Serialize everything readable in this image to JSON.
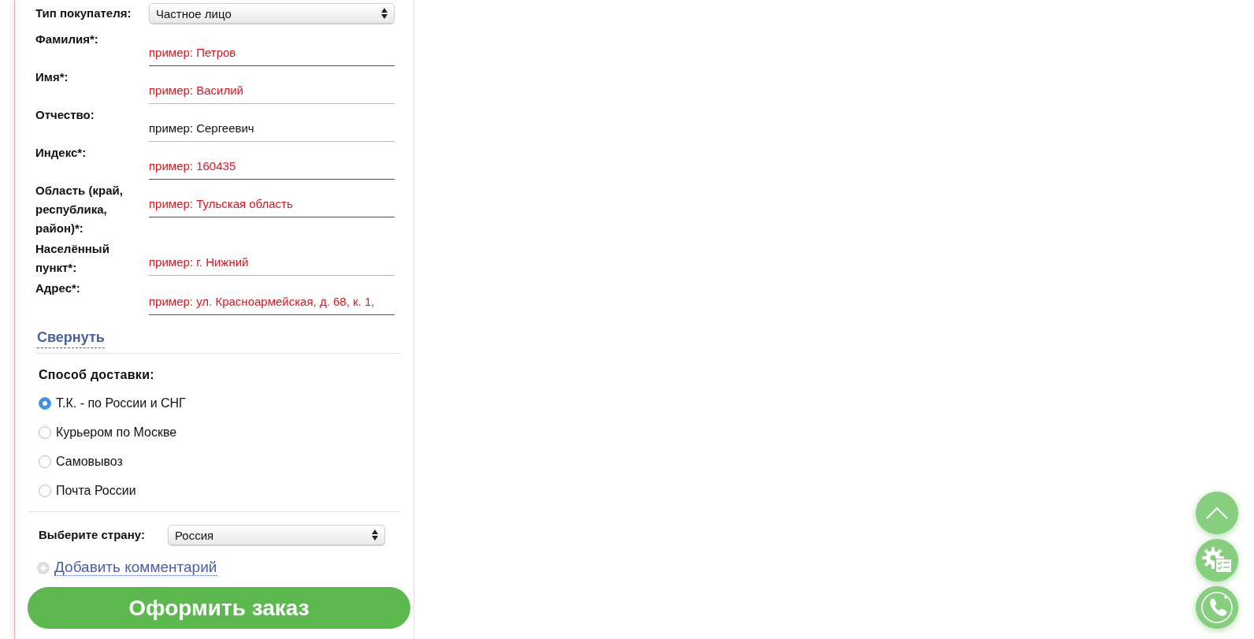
{
  "buyer_type": {
    "label": "Тип покупателя:",
    "value": "Частное лицо"
  },
  "fields": [
    {
      "label": "Фамилия*:",
      "placeholder": "пример: Петров",
      "required": true,
      "invalid": true
    },
    {
      "label": "Имя*:",
      "placeholder": "пример: Василий",
      "required": true,
      "invalid": false
    },
    {
      "label": "Отчество:",
      "placeholder": "пример: Сергеевич",
      "required": false,
      "invalid": false
    },
    {
      "label": "Индекс*:",
      "placeholder": "пример: 160435",
      "required": true,
      "invalid": true
    },
    {
      "label": "Область (край, республика, район)*:",
      "placeholder": "пример: Тульская область",
      "required": true,
      "invalid": true
    },
    {
      "label": "Населённый пункт*:",
      "placeholder": "пример: г. Нижний",
      "required": true,
      "invalid": false
    },
    {
      "label": "Адрес*:",
      "placeholder": "пример: ул. Красноармейская, д. 68, к. 1,",
      "required": true,
      "invalid": true
    }
  ],
  "collapse_link": "Свернуть",
  "delivery": {
    "title": "Способ доставки:",
    "options": [
      {
        "label": "Т.К. - по России и СНГ",
        "selected": true
      },
      {
        "label": "Курьером по Москве",
        "selected": false
      },
      {
        "label": "Самовывоз",
        "selected": false
      },
      {
        "label": "Почта России",
        "selected": false
      }
    ]
  },
  "country": {
    "label": "Выберите страну:",
    "value": "Россия"
  },
  "comment_link": "Добавить комментарий",
  "submit_button": "Оформить заказ"
}
